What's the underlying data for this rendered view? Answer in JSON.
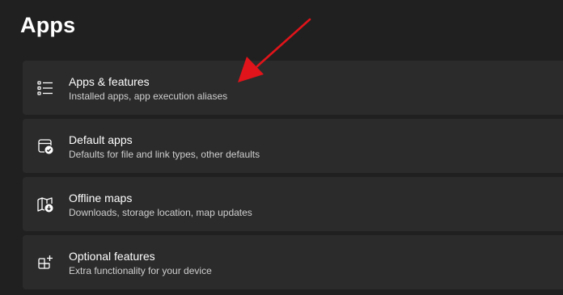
{
  "page": {
    "title": "Apps"
  },
  "items": [
    {
      "title": "Apps & features",
      "description": "Installed apps, app execution aliases",
      "icon": "list-icon"
    },
    {
      "title": "Default apps",
      "description": "Defaults for file and link types, other defaults",
      "icon": "default-apps-icon"
    },
    {
      "title": "Offline maps",
      "description": "Downloads, storage location, map updates",
      "icon": "map-download-icon"
    },
    {
      "title": "Optional features",
      "description": "Extra functionality for your device",
      "icon": "grid-add-icon"
    }
  ],
  "colors": {
    "background": "#202020",
    "card": "#2b2b2b",
    "annotation_arrow": "#e0141a"
  }
}
